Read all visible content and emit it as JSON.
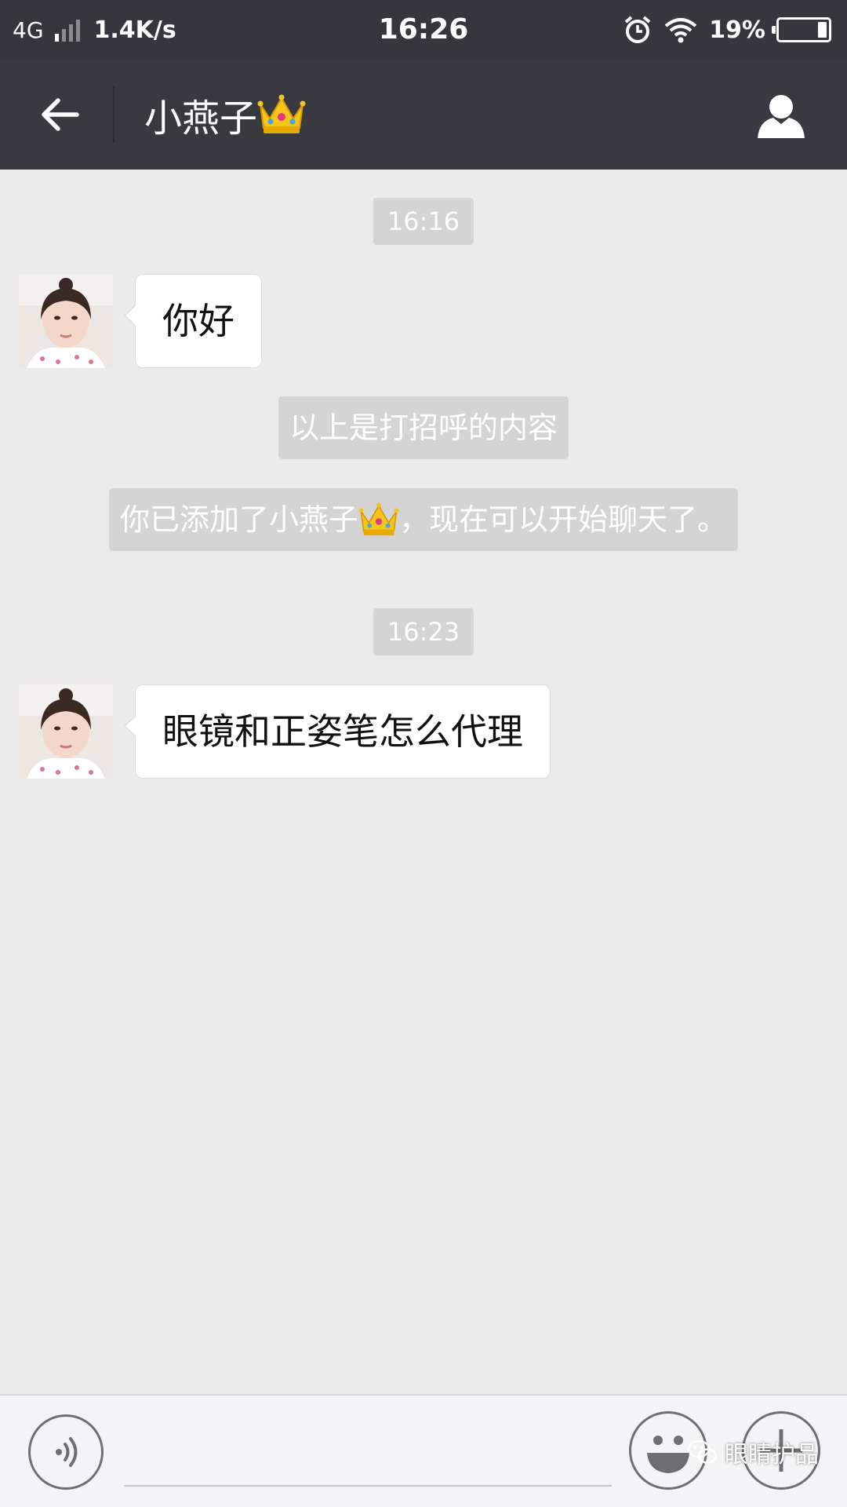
{
  "status_bar": {
    "network": "4G",
    "speed": "1.4K/s",
    "time": "16:26",
    "battery_percent": "19%",
    "battery_level": 0.19,
    "icons": [
      "signal-icon",
      "alarm-icon",
      "wifi-icon",
      "battery-icon"
    ]
  },
  "header": {
    "title": "小燕子",
    "title_emoji": "crown-icon",
    "back_icon": "back-arrow-icon",
    "profile_icon": "profile-icon",
    "background": "#393a3f"
  },
  "messages": [
    {
      "type": "timestamp",
      "text": "16:16"
    },
    {
      "type": "incoming",
      "text": "你好",
      "avatar": "avatar"
    },
    {
      "type": "system",
      "text": "以上是打招呼的内容"
    },
    {
      "type": "system",
      "text_before": "你已添加了小燕子",
      "emoji": "crown-icon",
      "text_after": "，现在可以开始聊天了。"
    },
    {
      "type": "timestamp",
      "text": "16:23"
    },
    {
      "type": "incoming",
      "text": "眼镜和正姿笔怎么代理",
      "avatar": "avatar"
    }
  ],
  "input_bar": {
    "value": "",
    "voice_icon": "voice-icon",
    "emoji_icon": "emoji-icon",
    "plus_icon": "plus-icon"
  },
  "watermark": {
    "text": "眼睛护品",
    "icon": "wechat-icon"
  },
  "colors": {
    "chat_background": "#ebebeb",
    "pill_background": "#d4d4d4",
    "bubble_background": "#ffffff"
  }
}
